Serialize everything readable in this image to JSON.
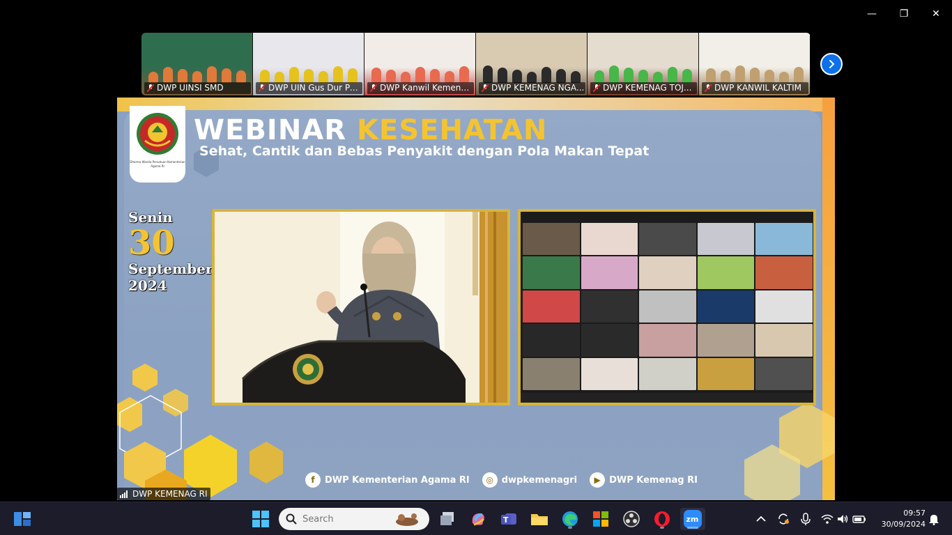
{
  "participants": [
    {
      "name": "DWP UINSI SMD",
      "wall": "#2f6d4f",
      "floor": "#7a5a3c",
      "people": "#e07a3a"
    },
    {
      "name": "DWP UIN Gus Dur Pe...",
      "wall": "#e8e8ec",
      "floor": "#b0b0b8",
      "people": "#e6c21e"
    },
    {
      "name": "DWP Kanwil Kemena...",
      "wall": "#f2ece8",
      "floor": "#c04848",
      "people": "#e86a50"
    },
    {
      "name": "DWP KEMENAG NGA...",
      "wall": "#d8cbb2",
      "floor": "#6a5a48",
      "people": "#2b2b2b"
    },
    {
      "name": "DWP KEMENAG TOJ...",
      "wall": "#e5dcd0",
      "floor": "#7a3c2c",
      "people": "#49b64a"
    },
    {
      "name": "DWP KANWIL KALTIM",
      "wall": "#f2efe8",
      "floor": "#9a7a50",
      "people": "#c0a070"
    }
  ],
  "slide": {
    "title_main": "WEBINAR",
    "title_accent": "KESEHATAN",
    "subtitle": "Sehat, Cantik dan Bebas Penyakit dengan Pola Makan Tepat",
    "logo_caption": "Dharma Wanita Persatuan Kementerian Agama RI",
    "day": "Senin",
    "date_num": "30",
    "month": "September",
    "year": "2024",
    "socials": [
      {
        "icon": "facebook-icon",
        "glyph": "f",
        "label": "DWP Kementerian Agama RI"
      },
      {
        "icon": "instagram-icon",
        "glyph": "◎",
        "label": "dwpkemenagri"
      },
      {
        "icon": "youtube-icon",
        "glyph": "▶",
        "label": "DWP Kemenag RI"
      }
    ]
  },
  "speaker_name": "DWP KEMENAG RI",
  "window": {
    "minimize": "—",
    "restore": "❐",
    "close": "✕"
  },
  "taskbar": {
    "search_placeholder": "Search",
    "time": "09:57",
    "date": "30/09/2024"
  },
  "colors": {
    "accent_gold": "#d7b53c",
    "zoom_blue": "#0e71eb",
    "taskbar_bg": "#1c1c2a"
  }
}
